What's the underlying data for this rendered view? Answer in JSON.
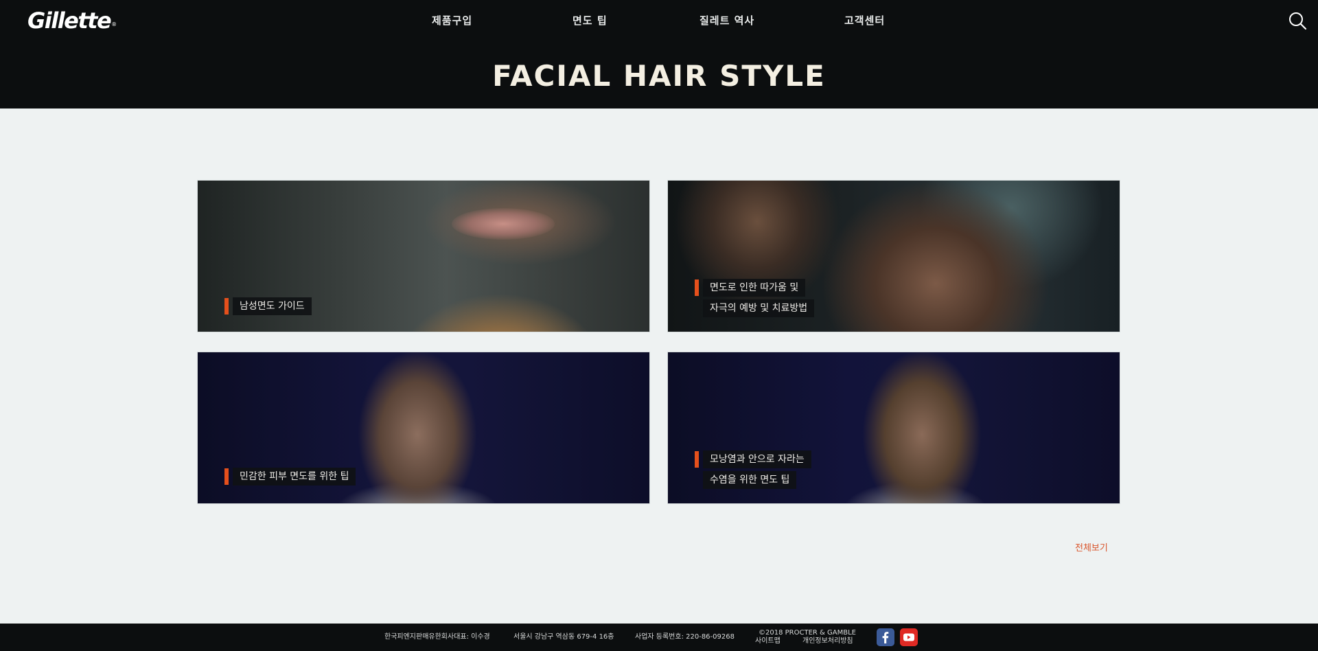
{
  "nav": {
    "logo": "Gillette",
    "logo_mark": "®",
    "items": [
      "제품구입",
      "면도 팁",
      "질레트 역사",
      "고객센터"
    ],
    "search_icon": "search-icon"
  },
  "hero": {
    "title": "FACIAL HAIR STYLE"
  },
  "cards": [
    {
      "lines": [
        "남성면도 가이드"
      ]
    },
    {
      "lines": [
        "면도로 인한 따가움 및",
        "자극의 예방 및 치료방법"
      ]
    },
    {
      "lines": [
        "민감한 피부 면도를 위한 팁"
      ]
    },
    {
      "lines": [
        "모낭염과 안으로 자라는",
        "수염을 위한 면도 팁"
      ]
    }
  ],
  "view_all": "전체보기",
  "footer": {
    "company": "한국피엔지판매유한회사대표: 이수경",
    "address": "서울시 강남구 역삼동 679-4 16층",
    "business_number": "사업자 등록번호: 220-86-09268",
    "copyright": "©2018 PROCTER & GAMBLE",
    "sitemap": "사이트맵",
    "privacy": "개인정보처리방침",
    "social": [
      "facebook-icon",
      "youtube-icon"
    ]
  },
  "colors": {
    "accent": "#e5501c",
    "link": "#d9542a",
    "nav_bg": "#0c0e0f",
    "page_bg": "#eef2f2"
  }
}
